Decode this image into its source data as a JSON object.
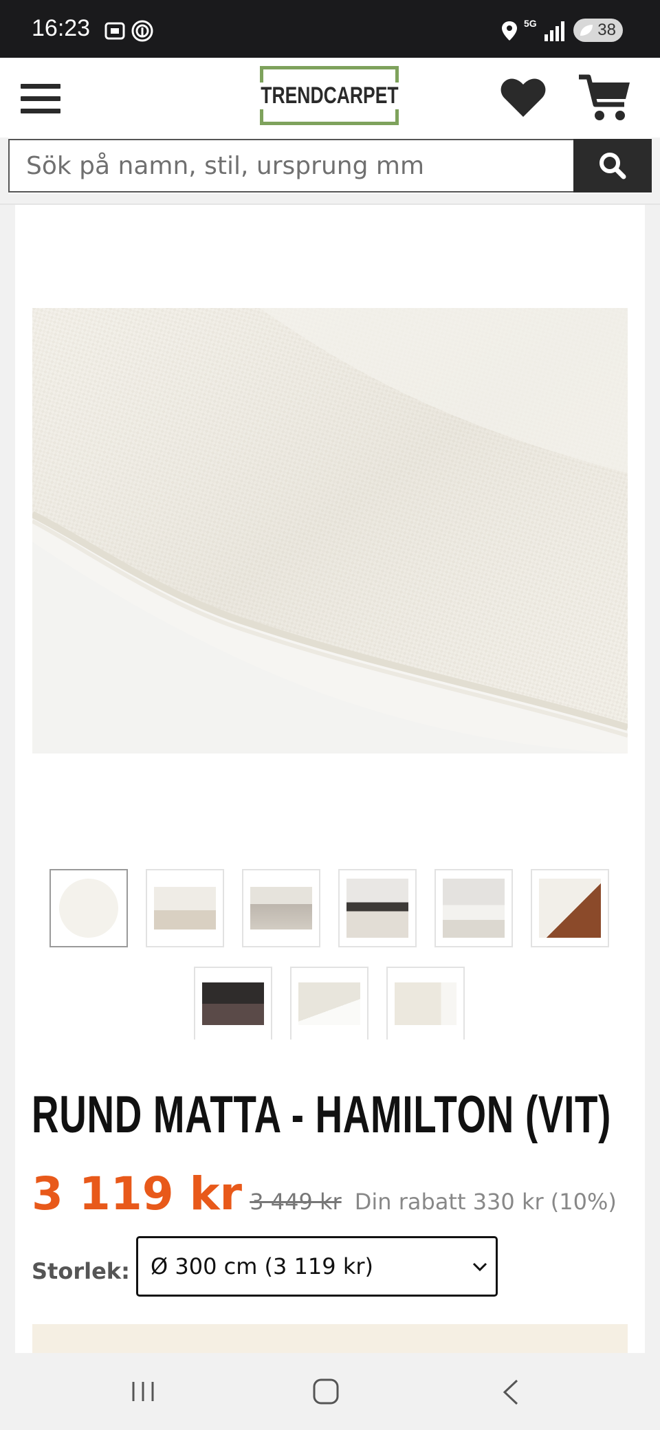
{
  "status_bar": {
    "time": "16:23",
    "battery": "38",
    "network": "5G"
  },
  "header": {
    "logo_text": "TRENDCARPET",
    "menu_icon": "hamburger-icon",
    "favorites_icon": "heart-icon",
    "cart_icon": "cart-icon"
  },
  "search": {
    "placeholder": "Sök på namn, stil, ursprung mm",
    "button_icon": "search-icon"
  },
  "product": {
    "title": "RUND MATTA - HAMILTON (VIT)",
    "price": "3 119 kr",
    "old_price": "3 449 kr",
    "discount": "Din rabatt 330 kr (10%)",
    "size_label": "Storlek:",
    "size_value": "Ø 300 cm (3 119 kr)",
    "thumbnail_count": 9,
    "selected_thumbnail": 1
  },
  "colors": {
    "accent": "#e8591a",
    "logo_border": "#7ea25c",
    "dark": "#2b2b2b"
  }
}
